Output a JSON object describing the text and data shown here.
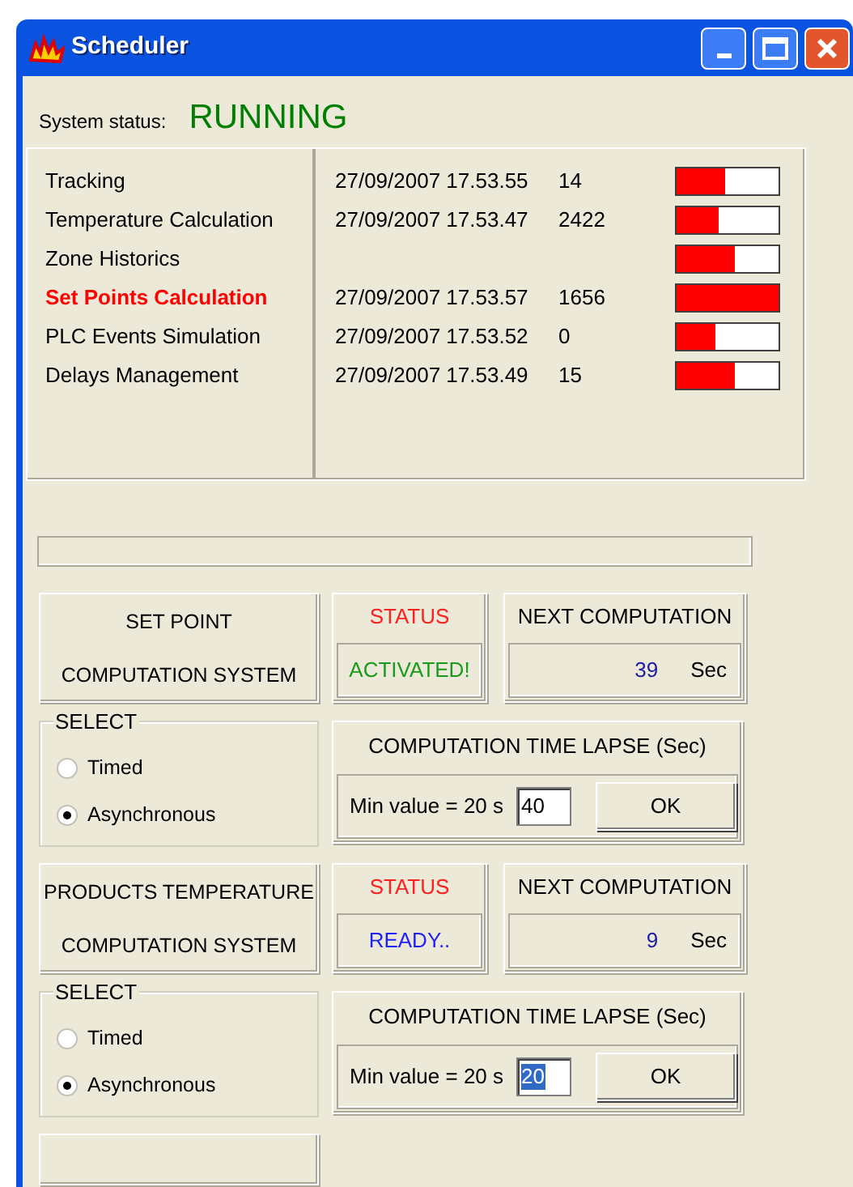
{
  "window": {
    "title": "Scheduler"
  },
  "system_status": {
    "label": "System status:",
    "value": "RUNNING"
  },
  "tasks": [
    {
      "name": "Tracking",
      "time": "27/09/2007 17.53.55",
      "count": "14",
      "level": 0.47,
      "active": false
    },
    {
      "name": "Temperature Calculation",
      "time": "27/09/2007 17.53.47",
      "count": "2422",
      "level": 0.42,
      "active": false
    },
    {
      "name": "Zone Historics",
      "level": 0.57,
      "active": false
    },
    {
      "name": "Set Points Calculation",
      "time": "27/09/2007 17.53.57",
      "count": "1656",
      "level": 1,
      "active": true
    },
    {
      "name": "PLC Events Simulation",
      "time": "27/09/2007 17.53.52",
      "count": "0",
      "level": 0.38,
      "active": false
    },
    {
      "name": "Delays Management",
      "time": "27/09/2007 17.53.49",
      "count": "15",
      "level": 0.57,
      "active": false
    }
  ],
  "progress": {
    "level": 0
  },
  "systems": [
    {
      "title_lines": [
        "SET POINT",
        "COMPUTATION SYSTEM"
      ],
      "status_label": "STATUS",
      "status": "ACTIVATED!",
      "color": "#1a9a1a",
      "next_label": "NEXT COMPUTATION",
      "next_value": "39",
      "next_unit": "Sec",
      "select_label": "SELECT",
      "options": [
        {
          "label": "Timed",
          "selected": false
        },
        {
          "label": "Asynchronous",
          "selected": true
        }
      ],
      "lapse_label": "COMPUTATION TIME LAPSE (Sec)",
      "min_label": "Min value = 20 s",
      "lapse_value": "40",
      "lapse_value_highlighted": false,
      "ok": "OK"
    },
    {
      "title_lines": [
        "PRODUCTS TEMPERATURE",
        "COMPUTATION SYSTEM"
      ],
      "status_label": "STATUS",
      "status": "READY..",
      "color": "#2020ff",
      "next_label": "NEXT COMPUTATION",
      "next_value": "9",
      "next_unit": "Sec",
      "select_label": "SELECT",
      "options": [
        {
          "label": "Timed",
          "selected": false
        },
        {
          "label": "Asynchronous",
          "selected": true
        }
      ],
      "lapse_label": "COMPUTATION TIME LAPSE (Sec)",
      "min_label": "Min value = 20 s",
      "lapse_value": "20",
      "lapse_value_highlighted": true,
      "ok": "OK"
    }
  ]
}
